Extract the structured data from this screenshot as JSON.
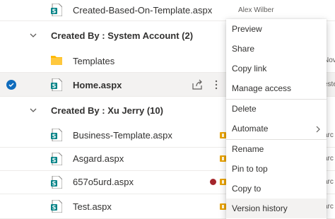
{
  "list": {
    "top_row": {
      "name": "Created-Based-On-Template.aspx",
      "author": "Alex Wilber"
    },
    "group_system": {
      "title": "Created By : System Account (2)"
    },
    "templates_row": {
      "name": "Templates",
      "edge": "Nove"
    },
    "home_row": {
      "name": "Home.aspx",
      "edge": "este"
    },
    "group_xu": {
      "title": "Created By : Xu Jerry (10)"
    },
    "files": [
      {
        "name": "Business-Template.aspx",
        "edge": "arc"
      },
      {
        "name": "Asgard.aspx",
        "edge": "arc"
      },
      {
        "name": "657o5urd.aspx",
        "edge": "arc"
      },
      {
        "name": "Test.aspx",
        "edge": "arc"
      }
    ]
  },
  "context_menu": {
    "items": [
      "Preview",
      "Share",
      "Copy link",
      "Manage access",
      "Delete",
      "Automate",
      "Rename",
      "Pin to top",
      "Copy to",
      "Version history"
    ]
  },
  "colors": {
    "accent": "#0f6cbd",
    "folder": "#ffb900",
    "sharepoint": "#038387",
    "warning": "#eaa300",
    "error": "#a4262c"
  }
}
